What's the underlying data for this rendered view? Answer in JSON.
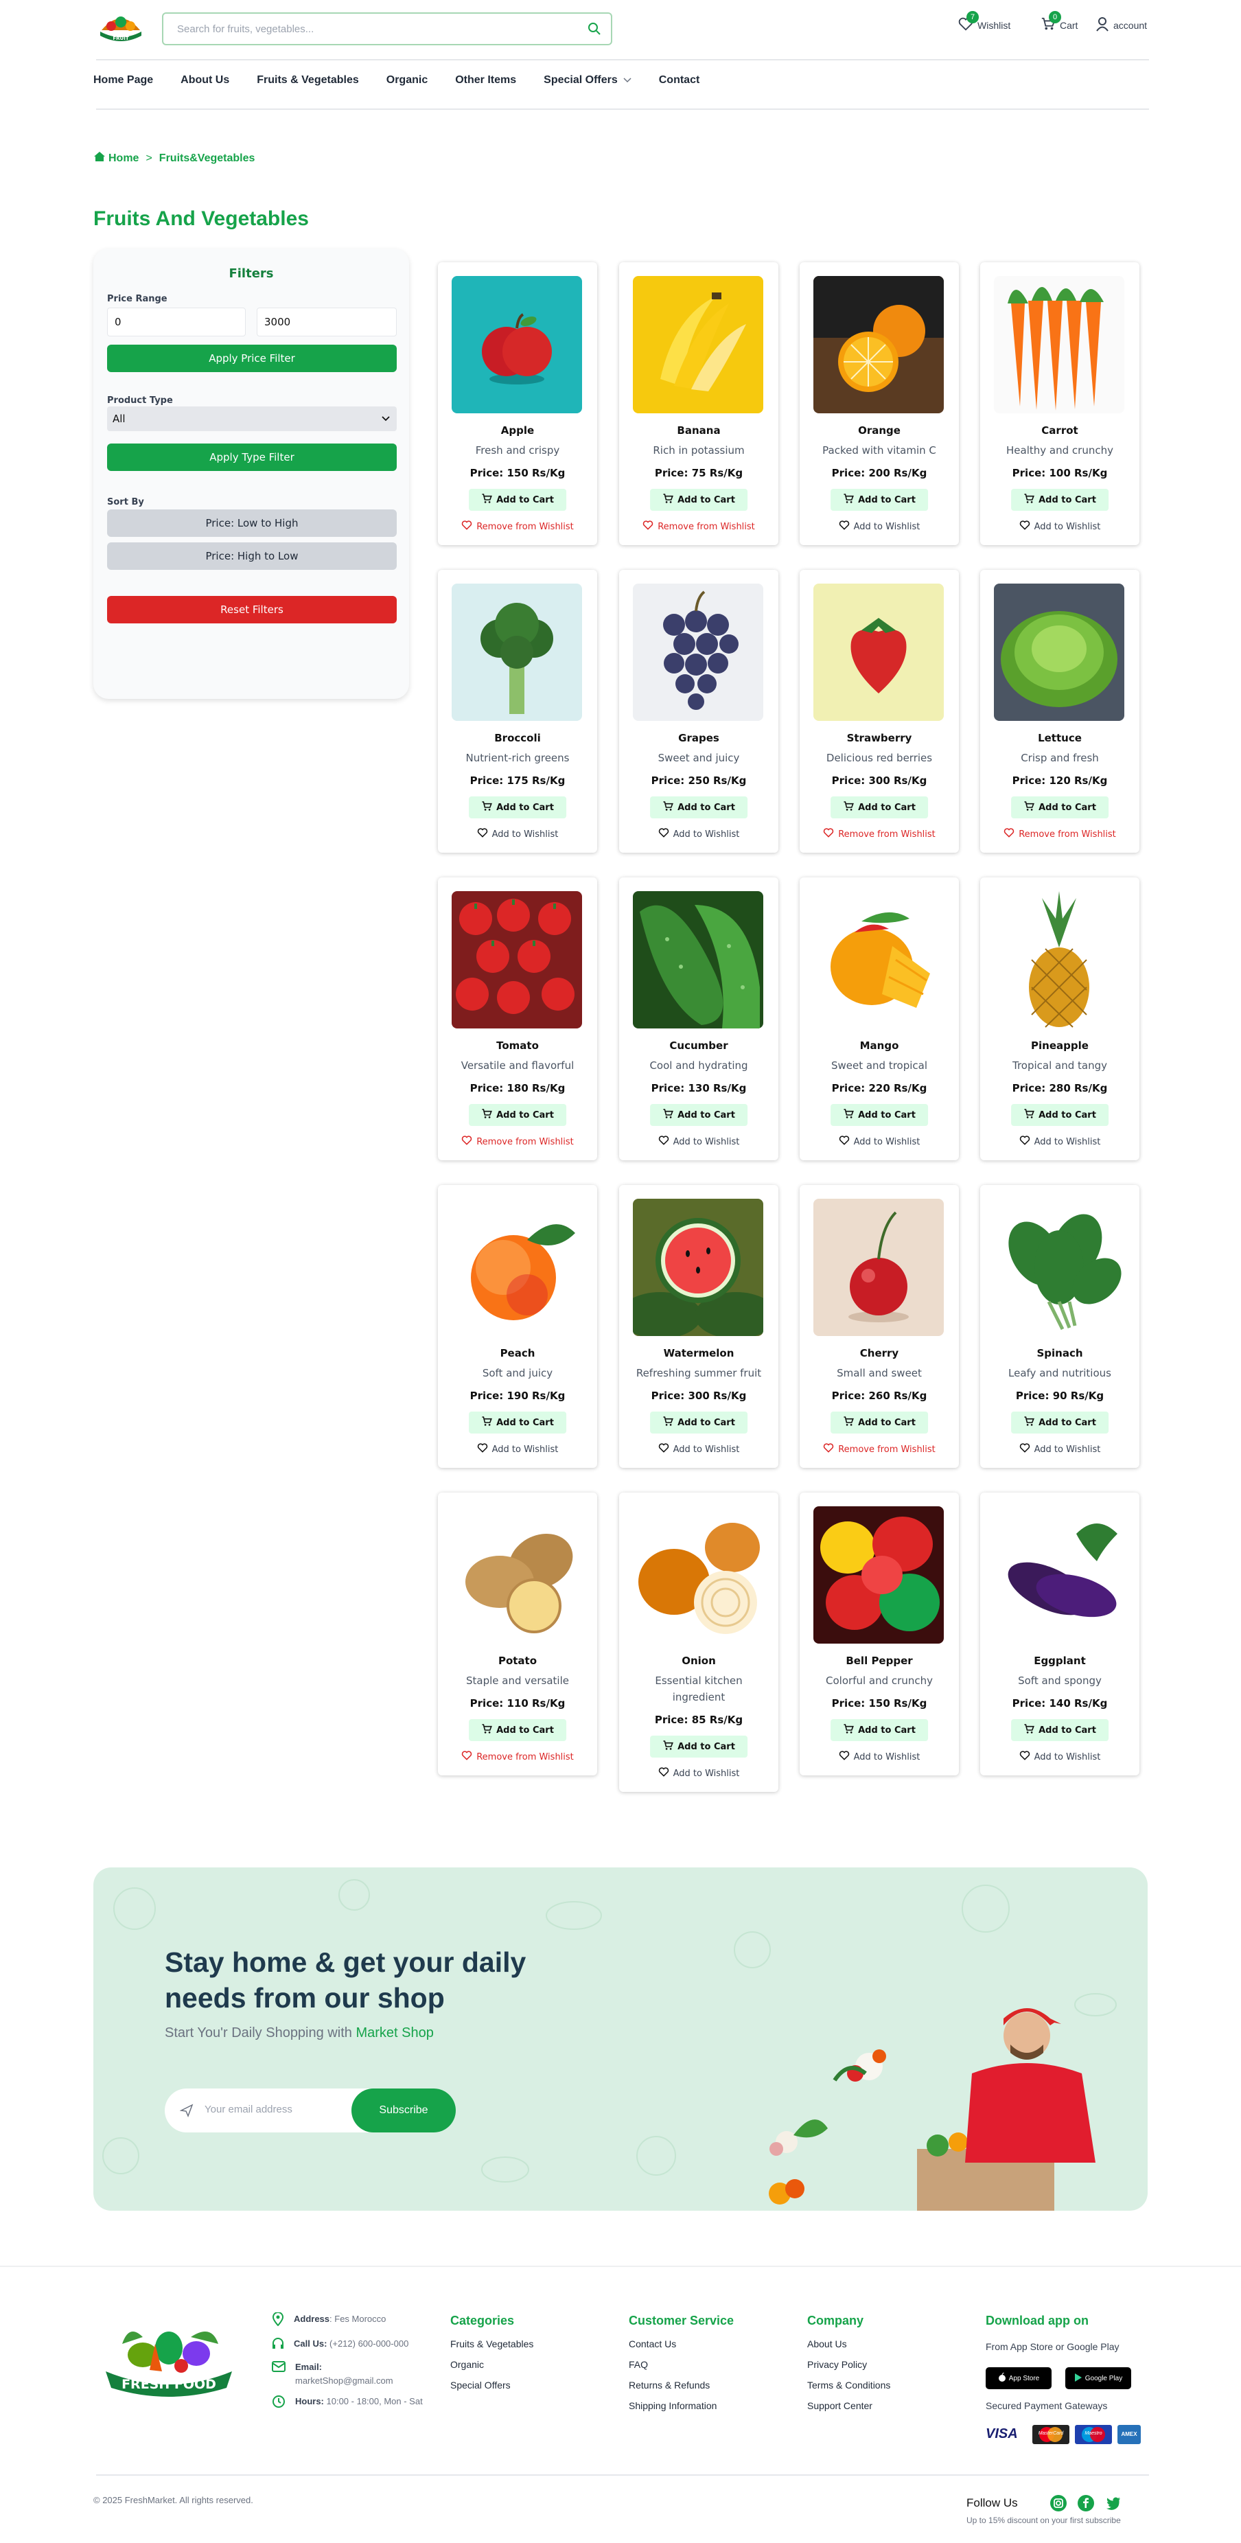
{
  "header": {
    "logo_text": "FRUIT VEGETABLE",
    "search_placeholder": "Search for fruits, vegetables...",
    "wishlist": {
      "label": "Wishlist",
      "count": "7"
    },
    "cart": {
      "label": "Cart",
      "count": "0"
    },
    "account_label": "account"
  },
  "nav": [
    {
      "label": "Home Page"
    },
    {
      "label": "About Us"
    },
    {
      "label": "Fruits & Vegetables"
    },
    {
      "label": "Organic"
    },
    {
      "label": "Other Items"
    },
    {
      "label": "Special Offers"
    },
    {
      "label": "Contact"
    }
  ],
  "breadcrumb": {
    "home": "Home",
    "separator": ">",
    "current": "Fruits&Vegetables"
  },
  "page_title": "Fruits And Vegetables",
  "filters": {
    "title": "Filters",
    "price_label": "Price Range",
    "price_min": "0",
    "price_max": "3000",
    "apply_price": "Apply Price Filter",
    "type_label": "Product Type",
    "type_value": "All",
    "apply_type": "Apply Type Filter",
    "sort_label": "Sort By",
    "sort_low": "Price: Low to High",
    "sort_high": "Price: High to Low",
    "reset": "Reset Filters"
  },
  "products": [
    {
      "name": "Apple",
      "desc": "Fresh and crispy",
      "price": "Price: 150 Rs/Kg",
      "in_wishlist": true,
      "icon": "apple"
    },
    {
      "name": "Banana",
      "desc": "Rich in potassium",
      "price": "Price: 75 Rs/Kg",
      "in_wishlist": true,
      "icon": "banana"
    },
    {
      "name": "Orange",
      "desc": "Packed with vitamin C",
      "price": "Price: 200 Rs/Kg",
      "in_wishlist": false,
      "icon": "orange"
    },
    {
      "name": "Carrot",
      "desc": "Healthy and crunchy",
      "price": "Price: 100 Rs/Kg",
      "in_wishlist": false,
      "icon": "carrot"
    },
    {
      "name": "Broccoli",
      "desc": "Nutrient-rich greens",
      "price": "Price: 175 Rs/Kg",
      "in_wishlist": false,
      "icon": "broccoli"
    },
    {
      "name": "Grapes",
      "desc": "Sweet and juicy",
      "price": "Price: 250 Rs/Kg",
      "in_wishlist": false,
      "icon": "grapes"
    },
    {
      "name": "Strawberry",
      "desc": "Delicious red berries",
      "price": "Price: 300 Rs/Kg",
      "in_wishlist": true,
      "icon": "strawberry"
    },
    {
      "name": "Lettuce",
      "desc": "Crisp and fresh",
      "price": "Price: 120 Rs/Kg",
      "in_wishlist": true,
      "icon": "lettuce"
    },
    {
      "name": "Tomato",
      "desc": "Versatile and flavorful",
      "price": "Price: 180 Rs/Kg",
      "in_wishlist": true,
      "icon": "tomato"
    },
    {
      "name": "Cucumber",
      "desc": "Cool and hydrating",
      "price": "Price: 130 Rs/Kg",
      "in_wishlist": false,
      "icon": "cucumber"
    },
    {
      "name": "Mango",
      "desc": "Sweet and tropical",
      "price": "Price: 220 Rs/Kg",
      "in_wishlist": false,
      "icon": "mango"
    },
    {
      "name": "Pineapple",
      "desc": "Tropical and tangy",
      "price": "Price: 280 Rs/Kg",
      "in_wishlist": false,
      "icon": "pineapple"
    },
    {
      "name": "Peach",
      "desc": "Soft and juicy",
      "price": "Price: 190 Rs/Kg",
      "in_wishlist": false,
      "icon": "peach"
    },
    {
      "name": "Watermelon",
      "desc": "Refreshing summer fruit",
      "price": "Price: 300 Rs/Kg",
      "in_wishlist": false,
      "icon": "watermelon"
    },
    {
      "name": "Cherry",
      "desc": "Small and sweet",
      "price": "Price: 260 Rs/Kg",
      "in_wishlist": true,
      "icon": "cherry"
    },
    {
      "name": "Spinach",
      "desc": "Leafy and nutritious",
      "price": "Price: 90 Rs/Kg",
      "in_wishlist": false,
      "icon": "spinach"
    },
    {
      "name": "Potato",
      "desc": "Staple and versatile",
      "price": "Price: 110 Rs/Kg",
      "in_wishlist": true,
      "icon": "potato"
    },
    {
      "name": "Onion",
      "desc": "Essential kitchen ingredient",
      "price": "Price: 85 Rs/Kg",
      "in_wishlist": false,
      "icon": "onion"
    },
    {
      "name": "Bell Pepper",
      "desc": "Colorful and crunchy",
      "price": "Price: 150 Rs/Kg",
      "in_wishlist": false,
      "icon": "bell-pepper"
    },
    {
      "name": "Eggplant",
      "desc": "Soft and spongy",
      "price": "Price: 140 Rs/Kg",
      "in_wishlist": false,
      "icon": "eggplant"
    }
  ],
  "product_actions": {
    "add_to_cart": "Add to Cart",
    "add_wishlist": "Add to Wishlist",
    "remove_wishlist": "Remove from Wishlist"
  },
  "banner": {
    "heading": "Stay home & get your daily needs from our shop",
    "sub_prefix": "Start You'r Daily Shopping with ",
    "sub_brand": "Market Shop",
    "email_placeholder": "Your email address",
    "subscribe": "Subscribe"
  },
  "footer": {
    "logo_text": "FRESH FOOD",
    "contact": [
      {
        "label": "Address",
        "value": ": Fes Morocco",
        "icon": "location-icon"
      },
      {
        "label": "Call Us:",
        "value": " (+212) 600-000-000",
        "icon": "headset-icon"
      },
      {
        "label": "Email:",
        "value": "marketShop@gmail.com",
        "icon": "mail-icon"
      },
      {
        "label": "Hours:",
        "value": " 10:00 - 18:00, Mon - Sat",
        "icon": "clock-icon"
      }
    ],
    "categories": {
      "title": "Categories",
      "links": [
        "Fruits & Vegetables",
        "Organic",
        "Special Offers"
      ]
    },
    "customer_service": {
      "title": "Customer Service",
      "links": [
        "Contact Us",
        "FAQ",
        "Returns & Refunds",
        "Shipping Information"
      ]
    },
    "company": {
      "title": "Company",
      "links": [
        "About Us",
        "Privacy Policy",
        "Terms & Conditions",
        "Support Center"
      ]
    },
    "app": {
      "title": "Download app on",
      "sub": "From App Store or Google Play",
      "appstore": "App Store",
      "googleplay": "Google Play",
      "payments_label": "Secured Payment Gateways",
      "visa": "VISA",
      "mastercard": "MasterCard",
      "maestro": "Maestro",
      "amex": "AMEX"
    },
    "copyright": "© 2025 FreshMarket. All rights reserved.",
    "follow": "Follow Us",
    "follow_sub": "Up to 15% discount on your first subscribe"
  },
  "colors": {
    "brand_green": "#16a34a",
    "danger_red": "#dc2626",
    "banner_bg": "#d9efe3"
  }
}
